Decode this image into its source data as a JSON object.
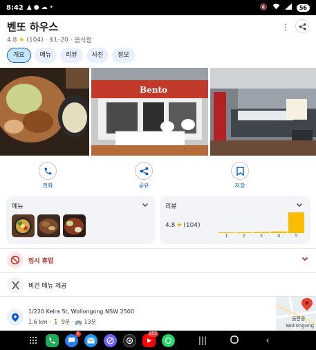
{
  "status": {
    "time": "8:42",
    "notif_icons": [
      "alert-icon",
      "chat-icon",
      "cloud-icon",
      "dot-icon"
    ],
    "right_icons": [
      "mute-icon",
      "wifi-icon",
      "signal-icon"
    ],
    "battery": "56"
  },
  "place": {
    "title": "벤또 하우스",
    "rating": "4.8",
    "review_count": "(104)",
    "price": "$1–20",
    "category": "음식점"
  },
  "tabs": [
    "개요",
    "메뉴",
    "리뷰",
    "사진",
    "정보"
  ],
  "actions": [
    {
      "label": "전화",
      "icon": "phone-icon"
    },
    {
      "label": "공유",
      "icon": "share-icon"
    },
    {
      "label": "저장",
      "icon": "bookmark-icon"
    }
  ],
  "menu_card": {
    "title": "메뉴"
  },
  "review_card": {
    "title": "리뷰",
    "rating": "4.8",
    "count": "(104)"
  },
  "chart_data": {
    "type": "bar",
    "categories": [
      "1",
      "2",
      "3",
      "4",
      "5"
    ],
    "values": [
      0.04,
      0.05,
      0.06,
      0.08,
      1.0
    ],
    "accent": "#fbbc04"
  },
  "rows": {
    "closed": "임시 휴업",
    "vegan": "비건 메뉴 제공",
    "address": "1/220 Keira St, Wollongong NSW 2500",
    "travel": "1.6 km · 🚶 9분 · 🚌 13분",
    "map_label_1": "울란공",
    "map_label_2": "Wollongong"
  },
  "nav": {
    "apps": [
      {
        "name": "app-drawer-icon"
      },
      {
        "name": "phone-app-icon",
        "color": "#1faa59"
      },
      {
        "name": "messages-app-icon",
        "color": "#2b7de9",
        "badge": "1"
      },
      {
        "name": "email-app-icon",
        "color": "#2196f3"
      },
      {
        "name": "browser-app-icon",
        "color": "#6b5fff"
      },
      {
        "name": "chatgpt-app-icon",
        "color": "#222222"
      },
      {
        "name": "youtube-app-icon",
        "color": "#ff0000",
        "badge": "253"
      },
      {
        "name": "whatsapp-app-icon",
        "color": "#25d366"
      }
    ],
    "sys": [
      "recents-button",
      "home-button",
      "back-button"
    ]
  },
  "colors": {
    "primary": "#0b57d0",
    "star": "#f9ab00",
    "closed": "#b3261e"
  }
}
